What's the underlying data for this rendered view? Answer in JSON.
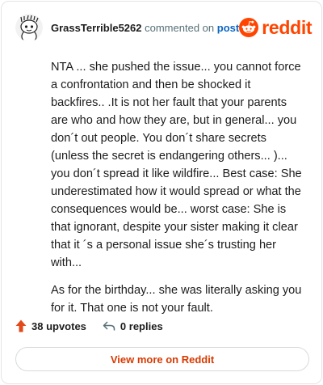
{
  "header": {
    "username": "GrassTerrible5262",
    "action_text": "commented on",
    "target_text": "post",
    "brand": "reddit"
  },
  "comment": {
    "paragraphs": [
      "NTA ... she pushed the issue... you cannot force a confrontation and then be shocked it backfires.. .It is not her fault that your parents are who and how they are, but in general... you don´t out people. You don´t share secrets (unless the secret is endangering others... )... you don´t spread it like wildfire... Best case: She underestimated how it would spread or what the consequences would be... worst case: She is that ignorant, despite your sister making it clear that it ´s a personal issue she´s trusting her with...",
      "As for the birthday... she was literally asking you for it. That one is not your fault."
    ]
  },
  "footer": {
    "upvotes": "38 upvotes",
    "replies": "0 replies",
    "view_more": "View more on Reddit"
  },
  "colors": {
    "brand": "#ff4500",
    "link": "#0a66c2",
    "view_more_text": "#d93900"
  },
  "icons": {
    "avatar": "snoo-avatar",
    "brand": "reddit-logo-icon",
    "upvote": "upvote-arrow-icon",
    "reply": "reply-arrow-icon"
  }
}
